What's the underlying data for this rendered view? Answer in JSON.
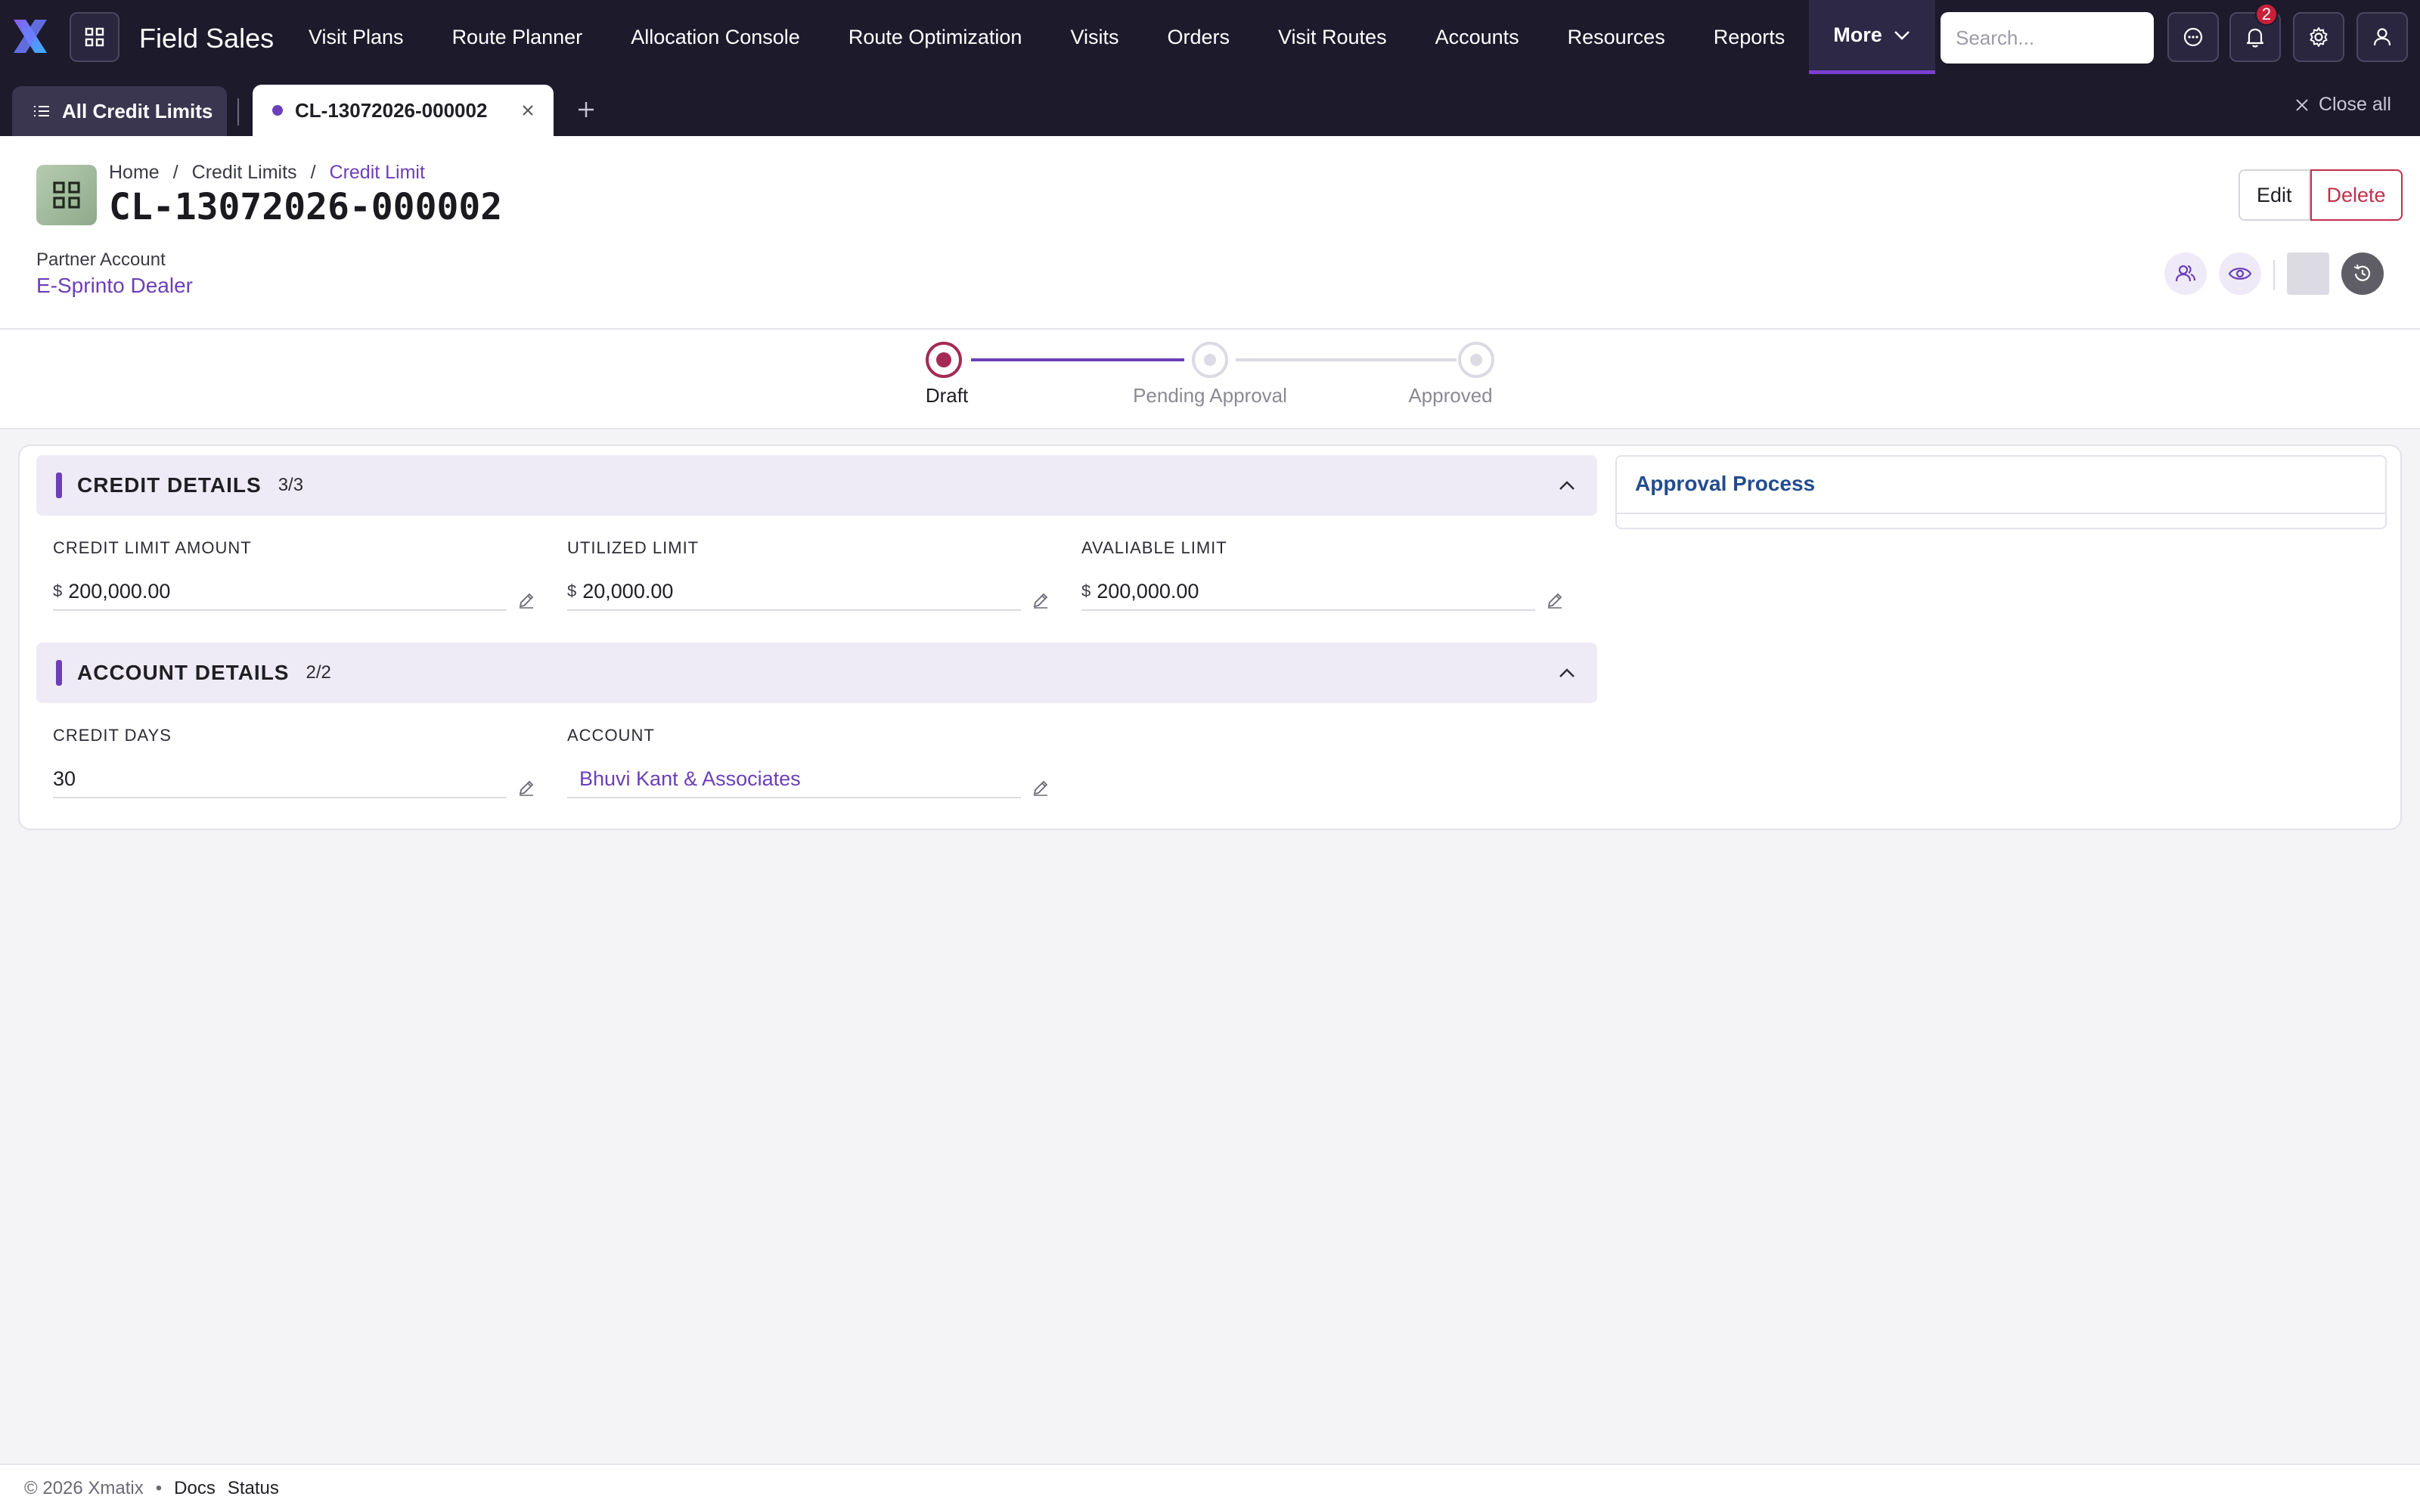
{
  "app": {
    "title": "Field Sales",
    "logo_icon": "x-logo"
  },
  "nav": {
    "items": [
      "Visit Plans",
      "Route Planner",
      "Allocation Console",
      "Route Optimization",
      "Visits",
      "Orders",
      "Visit Routes",
      "Accounts",
      "Resources",
      "Reports"
    ],
    "more_label": "More"
  },
  "search": {
    "placeholder": "Search..."
  },
  "notifications": {
    "count": "2"
  },
  "tabs": {
    "all_label": "All Credit Limits",
    "active_label": "CL-13072026-000002",
    "close_all_label": "Close all"
  },
  "breadcrumb": {
    "home": "Home",
    "section": "Credit Limits",
    "current": "Credit Limit",
    "separator": "/"
  },
  "record": {
    "title": "CL-13072026-000002",
    "partner_label": "Partner Account",
    "partner_value": "E-Sprinto Dealer",
    "edit_label": "Edit",
    "delete_label": "Delete"
  },
  "stepper": {
    "steps": [
      "Draft",
      "Pending Approval",
      "Approved"
    ],
    "current_index": 0
  },
  "credit_details": {
    "title": "CREDIT DETAILS",
    "count": "3/3",
    "fields": [
      {
        "label": "CREDIT LIMIT AMOUNT",
        "currency": "$",
        "value": "200,000.00"
      },
      {
        "label": "UTILIZED LIMIT",
        "currency": "$",
        "value": "20,000.00"
      },
      {
        "label": "AVALIABLE LIMIT",
        "currency": "$",
        "value": "200,000.00"
      }
    ]
  },
  "account_details": {
    "title": "ACCOUNT DETAILS",
    "count": "2/2",
    "fields": [
      {
        "label": "CREDIT DAYS",
        "value": "30"
      },
      {
        "label": "ACCOUNT",
        "value": "Bhuvi Kant & Associates"
      }
    ]
  },
  "approval": {
    "title": "Approval Process"
  },
  "footer": {
    "copyright": "© 2026 Xmatix",
    "bullet": "•",
    "docs": "Docs",
    "status": "Status"
  },
  "colors": {
    "accent": "#6b3fb8",
    "nav_bg": "#1d1a2c",
    "danger": "#c0304a",
    "draft_step": "#a52a55"
  }
}
